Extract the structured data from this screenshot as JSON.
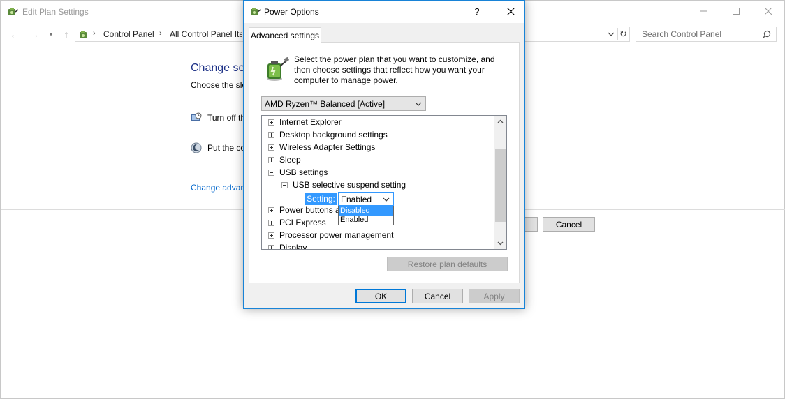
{
  "background_window": {
    "title": "Edit Plan Settings",
    "breadcrumbs": [
      "Control Panel",
      "All Control Panel Ite"
    ],
    "search_placeholder": "Search Control Panel",
    "heading": "Change setti",
    "subheading": "Choose the sleep",
    "rows": [
      {
        "label": "Turn off the",
        "icon": "monitor-clock-icon"
      },
      {
        "label": "Put the com",
        "icon": "sleep-moon-icon"
      }
    ],
    "advanced_link": "Change advanced",
    "cancel_label": "Cancel"
  },
  "dialog": {
    "title": "Power Options",
    "help_label": "?",
    "tab_label": "Advanced settings",
    "intro": "Select the power plan that you want to customize, and then choose settings that reflect how you want your computer to manage power.",
    "plan_selected": "AMD Ryzen™ Balanced [Active]",
    "tree_items": [
      {
        "label": "Internet Explorer",
        "expanded": false
      },
      {
        "label": "Desktop background settings",
        "expanded": false
      },
      {
        "label": "Wireless Adapter Settings",
        "expanded": false
      },
      {
        "label": "Sleep",
        "expanded": false
      },
      {
        "label": "USB settings",
        "expanded": true
      },
      {
        "label": "USB selective suspend setting",
        "expanded": true
      },
      {
        "label": "Power buttons a",
        "expanded": false
      },
      {
        "label": "PCI Express",
        "expanded": false
      },
      {
        "label": "Processor power management",
        "expanded": false
      },
      {
        "label": "Display",
        "expanded": false
      }
    ],
    "setting_label": "Setting:",
    "setting_value": "Enabled",
    "setting_options": [
      "Disabled",
      "Enabled"
    ],
    "highlighted_option": "Disabled",
    "restore_label": "Restore plan defaults",
    "ok_label": "OK",
    "cancel_label": "Cancel",
    "apply_label": "Apply"
  },
  "colors": {
    "accent": "#0078d7",
    "selection": "#3399ff",
    "link": "#0066cc",
    "heading": "#1e3287"
  }
}
